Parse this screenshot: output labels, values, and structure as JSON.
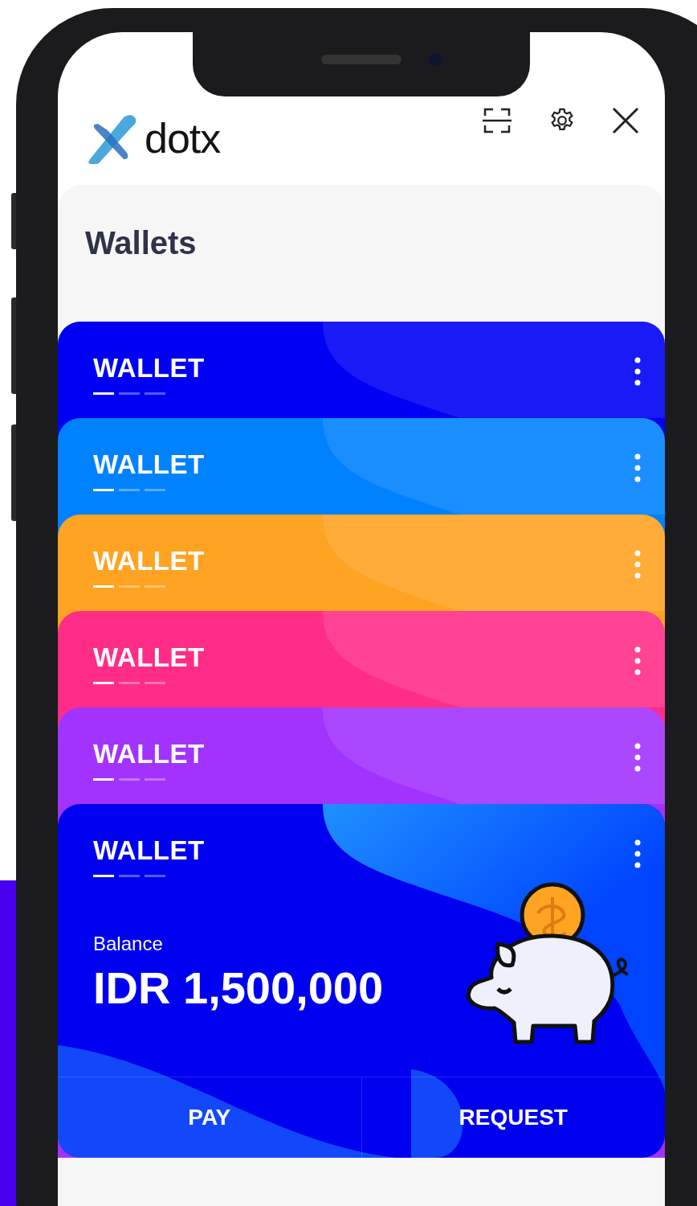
{
  "header": {
    "logo": "dotx"
  },
  "title": "Wallets",
  "wallets": [
    {
      "label": "WALLET",
      "color": "#0000f5"
    },
    {
      "label": "WALLET",
      "color": "#0082ff"
    },
    {
      "label": "WALLET",
      "color": "#ffa322"
    },
    {
      "label": "WALLET",
      "color": "#ff2d87"
    },
    {
      "label": "WALLET",
      "color": "#a233ff"
    },
    {
      "label": "WALLET",
      "color": "#0000f0"
    }
  ],
  "balance": {
    "label": "Balance",
    "amount": "IDR 1,500,000"
  },
  "actions": [
    "PAY",
    "REQUEST"
  ]
}
